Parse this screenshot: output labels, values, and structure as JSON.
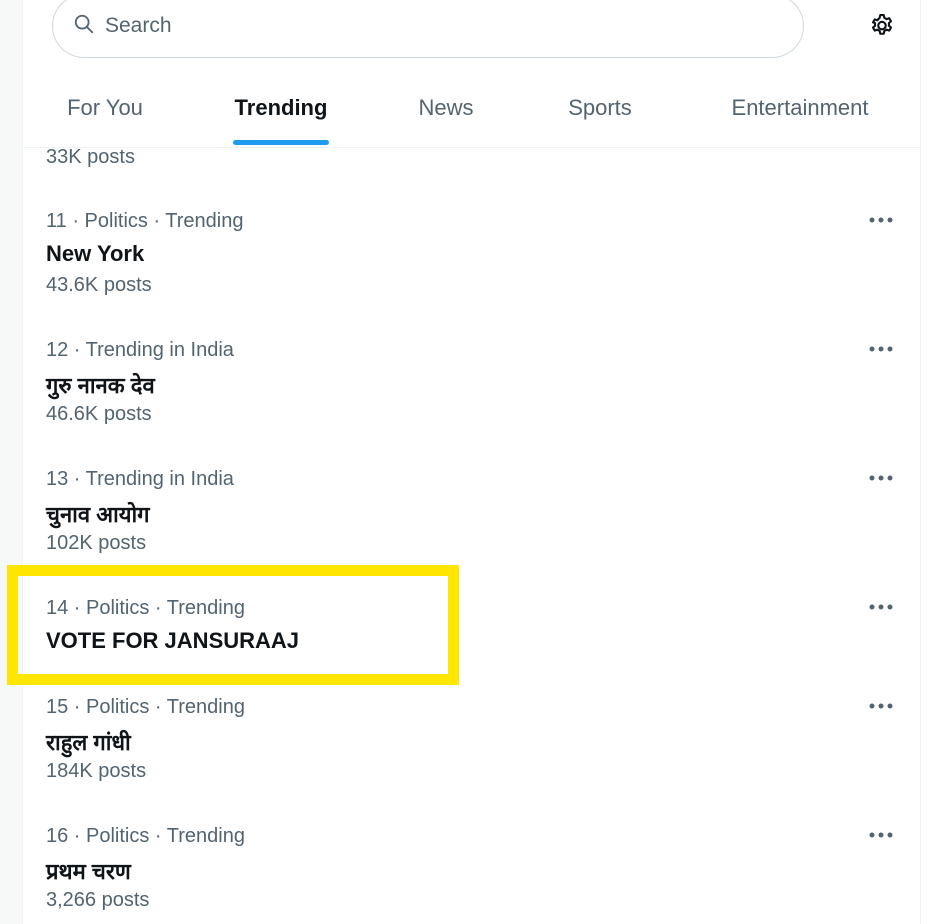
{
  "search": {
    "placeholder": "Search"
  },
  "tabs": [
    {
      "label": "For You"
    },
    {
      "label": "Trending"
    },
    {
      "label": "News"
    },
    {
      "label": "Sports"
    },
    {
      "label": "Entertainment"
    }
  ],
  "active_tab": "Trending",
  "previous_trend": {
    "count": "33K posts"
  },
  "trends": [
    {
      "meta": "11 · Politics · Trending",
      "name": "New York",
      "count": "43.6K posts"
    },
    {
      "meta": "12 · Trending in India",
      "name": "गुरु नानक देव",
      "count": "46.6K posts"
    },
    {
      "meta": "13 · Trending in India",
      "name": "चुनाव आयोग",
      "count": "102K posts"
    },
    {
      "meta": "14 · Politics · Trending",
      "name": "VOTE FOR JANSURAAJ",
      "count": ""
    },
    {
      "meta": "15 · Politics · Trending",
      "name": "राहुल गांधी",
      "count": "184K posts"
    },
    {
      "meta": "16 · Politics · Trending",
      "name": "प्रथम चरण",
      "count": "3,266 posts"
    }
  ],
  "colors": {
    "accent": "#1d9bf0",
    "highlight": "#ffe600",
    "secondary_text": "#536471",
    "primary_text": "#0f1419"
  },
  "icons": {
    "search": "search-icon",
    "settings": "gear-icon",
    "more": "more-options-icon"
  }
}
